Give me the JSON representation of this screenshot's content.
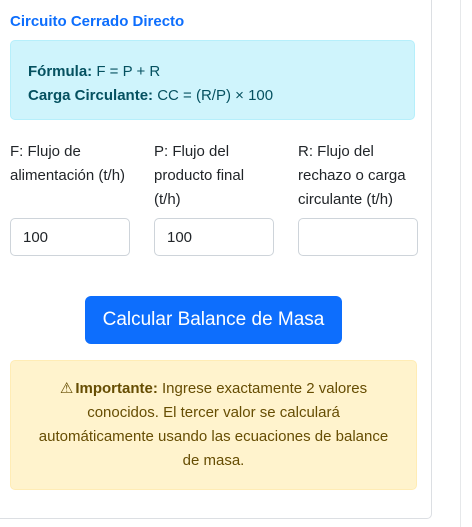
{
  "section": {
    "title": "Circuito Cerrado Directo"
  },
  "formula": {
    "formula_label": "Fórmula:",
    "formula_text": "F = P + R",
    "carga_label": "Carga Circulante:",
    "carga_text": "CC = (R/P) × 100"
  },
  "fields": [
    {
      "label": "F: Flujo de alimentación (t/h)",
      "value": "100",
      "placeholder": ""
    },
    {
      "label": "P: Flujo del producto final (t/h)",
      "value": "100",
      "placeholder": ""
    },
    {
      "label": "R: Flujo del rechazo o carga circulante (t/h)",
      "value": "",
      "placeholder": ""
    }
  ],
  "button": {
    "label": "Calcular Balance de Masa"
  },
  "warning": {
    "icon": "warning-triangle-icon",
    "strong": "Importante:",
    "text": "Ingrese exactamente 2 valores conocidos. El tercer valor se calculará automáticamente usando las ecuaciones de balance de masa."
  },
  "colors": {
    "primary": "#0d6efd",
    "info_bg": "#cff4fc",
    "warning_bg": "#fff3cd"
  }
}
